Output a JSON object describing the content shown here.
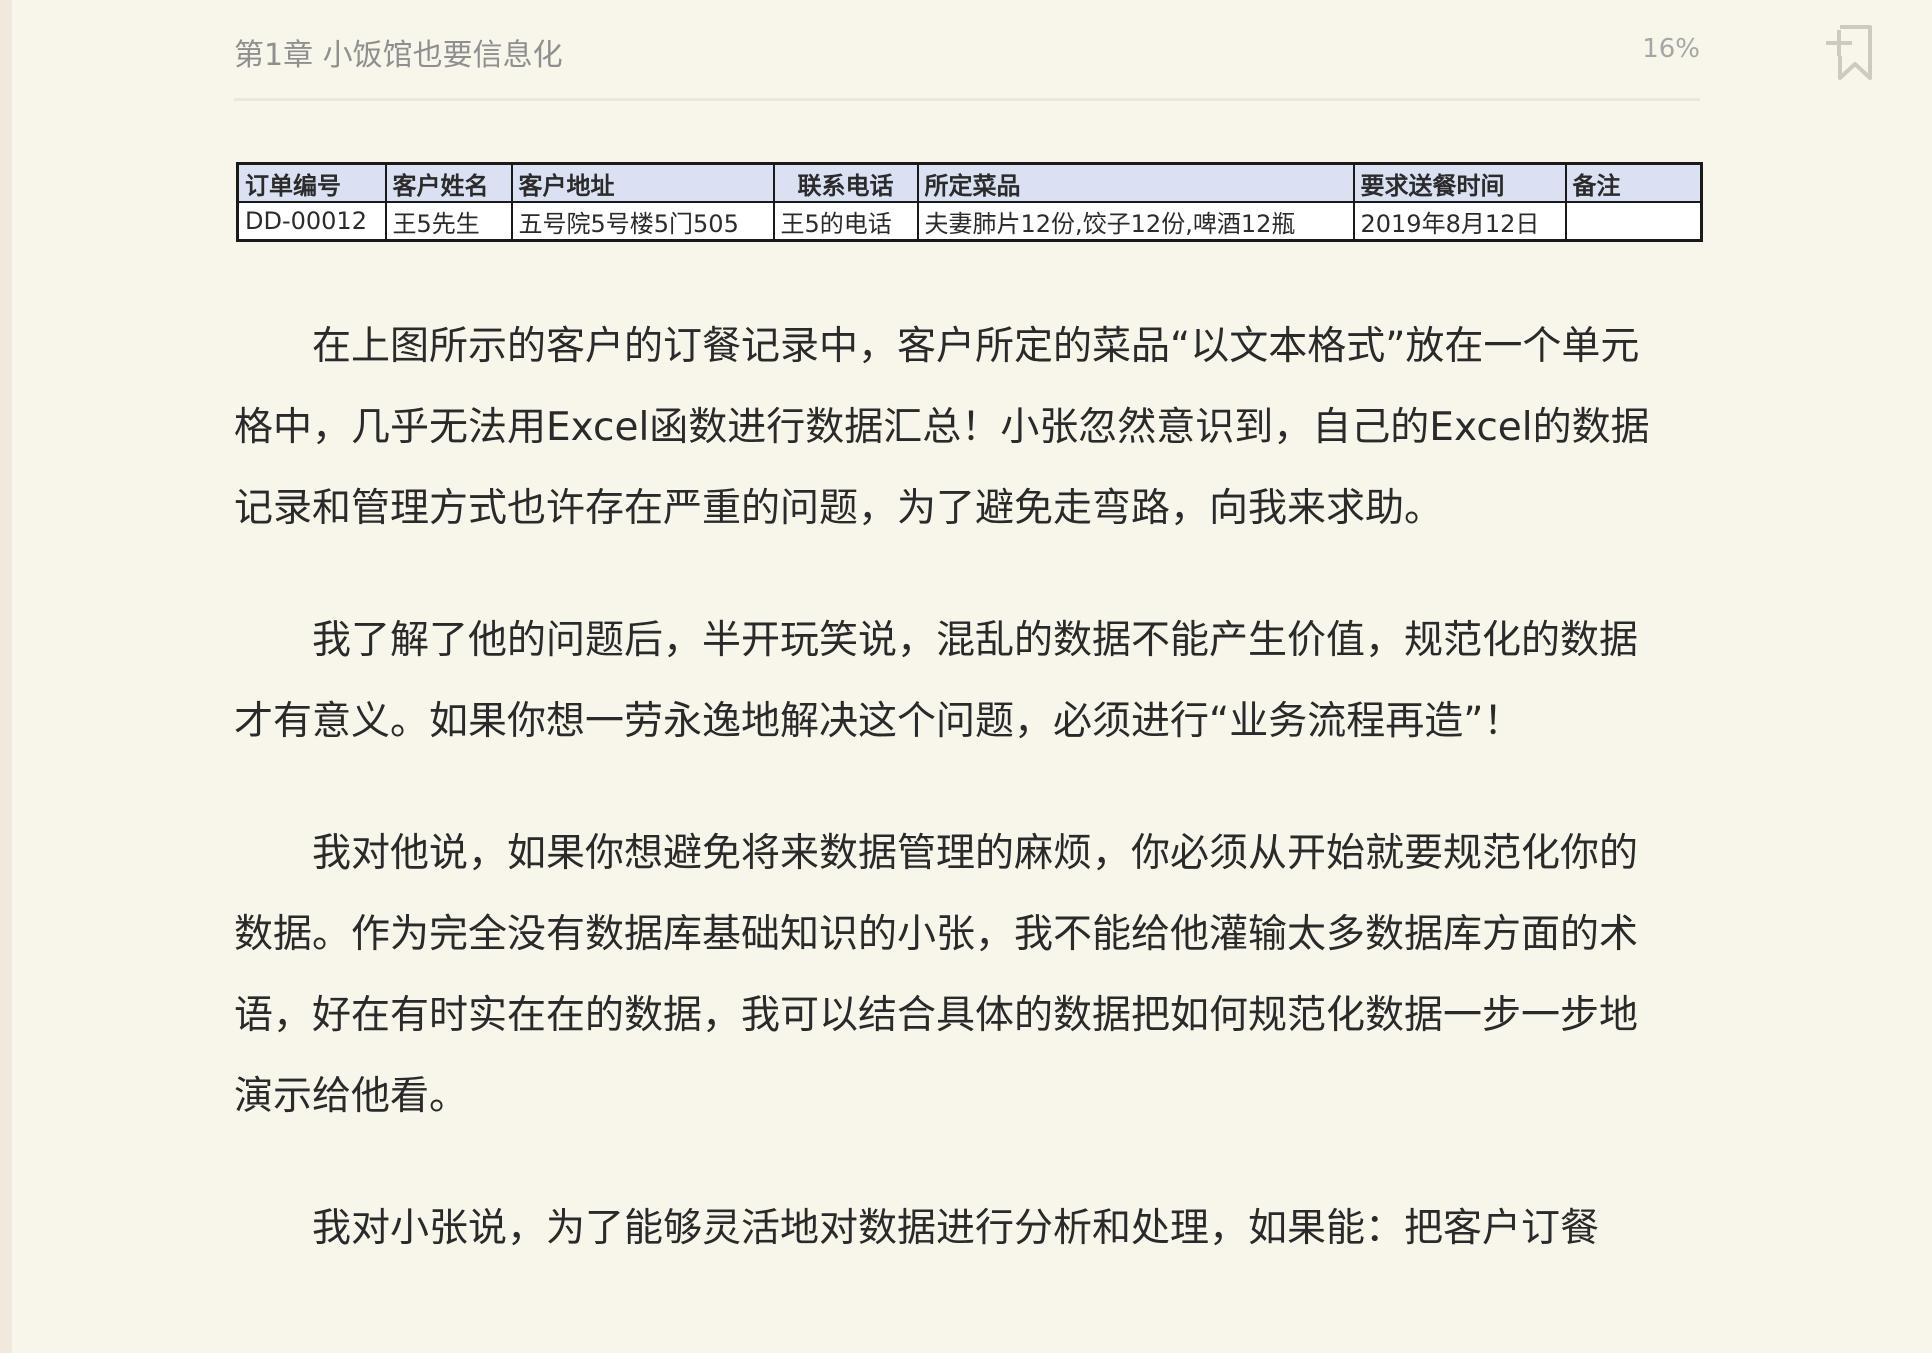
{
  "header": {
    "chapter_title": "第1章 小饭馆也要信息化",
    "progress": "16%"
  },
  "icons": {
    "bookmark": "add-bookmark-icon"
  },
  "table": {
    "headers": [
      "订单编号",
      "客户姓名",
      "客户地址",
      "联系电话",
      "所定菜品",
      "要求送餐时间",
      "备注"
    ],
    "rows": [
      [
        "DD-00012",
        "王5先生",
        "五号院5号楼5门505",
        "王5的电话",
        "夫妻肺片12份,饺子12份,啤酒12瓶",
        "2019年8月12日",
        ""
      ]
    ]
  },
  "paragraphs": [
    "在上图所示的客户的订餐记录中，客户所定的菜品“以文本格式”放在一个单元格中，几乎无法用Excel函数进行数据汇总！小张忽然意识到，自己的Excel的数据记录和管理方式也许存在严重的问题，为了避免走弯路，向我来求助。",
    "我了解了他的问题后，半开玩笑说，混乱的数据不能产生价值，规范化的数据才有意义。如果你想一劳永逸地解决这个问题，必须进行“业务流程再造”！",
    "我对他说，如果你想避免将来数据管理的麻烦，你必须从开始就要规范化你的数据。作为完全没有数据库基础知识的小张，我不能给他灌输太多数据库方面的术语，好在有时实在在的数据，我可以结合具体的数据把如何规范化数据一步一步地演示给他看。",
    "我对小张说，为了能够灵活地对数据进行分析和处理，如果能：把客户订餐"
  ]
}
